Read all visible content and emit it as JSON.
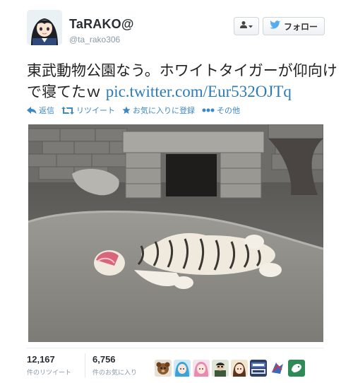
{
  "user": {
    "display_name": "TaRAKO@",
    "screen_name": "@ta_rako306"
  },
  "buttons": {
    "user_menu_icon": "person-icon",
    "follow_label": "フォロー",
    "follow_icon": "twitter-bird-icon"
  },
  "tweet": {
    "text": "東武動物公園なう。ホワイトタイガーが仰向けで寝てたｗ",
    "link": "pic.twitter.com/Eur532OJTq"
  },
  "actions": [
    {
      "label": "返信",
      "icon": "reply-icon"
    },
    {
      "label": "リツイート",
      "icon": "retweet-icon"
    },
    {
      "label": "お気に入りに登録",
      "icon": "star-icon"
    },
    {
      "label": "その他",
      "icon": "more-icon"
    }
  ],
  "stats": {
    "retweets": {
      "count": "12,167",
      "label": "件のリツイート"
    },
    "favorites": {
      "count": "6,756",
      "label": "件のお気に入り"
    }
  },
  "colors": {
    "link": "#2b7bb9",
    "action": "#3b88c3",
    "twitter_blue": "#55acee"
  }
}
